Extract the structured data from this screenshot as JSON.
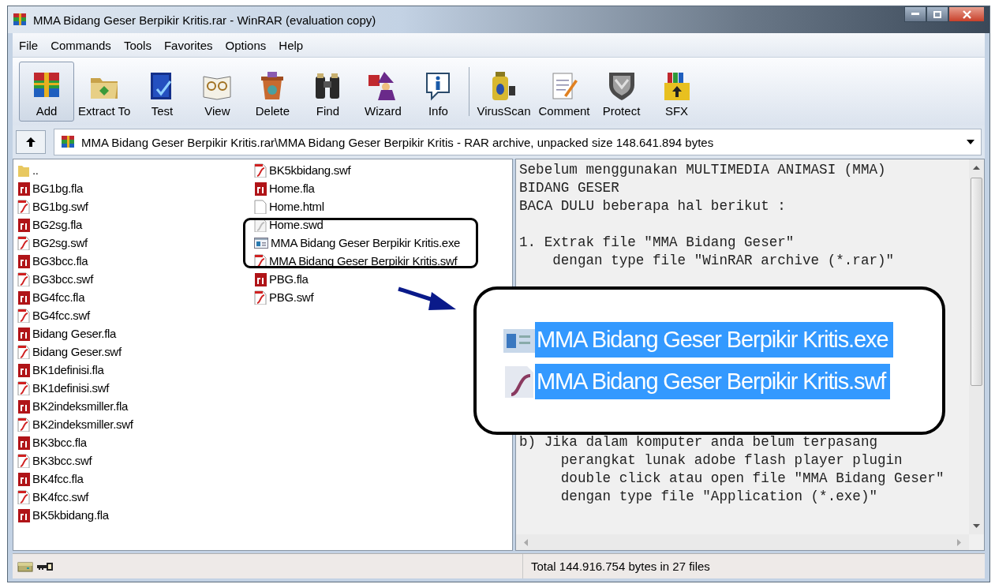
{
  "window": {
    "title": "MMA Bidang Geser Berpikir Kritis.rar - WinRAR (evaluation copy)"
  },
  "menu": [
    "File",
    "Commands",
    "Tools",
    "Favorites",
    "Options",
    "Help"
  ],
  "toolbar": {
    "groups": [
      [
        {
          "label": "Add",
          "selected": true
        },
        {
          "label": "Extract To",
          "selected": false
        },
        {
          "label": "Test",
          "selected": false
        },
        {
          "label": "View",
          "selected": false
        },
        {
          "label": "Delete",
          "selected": false
        },
        {
          "label": "Find",
          "selected": false
        },
        {
          "label": "Wizard",
          "selected": false
        },
        {
          "label": "Info",
          "selected": false
        }
      ],
      [
        {
          "label": "VirusScan",
          "selected": false
        },
        {
          "label": "Comment",
          "selected": false
        },
        {
          "label": "Protect",
          "selected": false
        },
        {
          "label": "SFX",
          "selected": false
        }
      ]
    ]
  },
  "address": {
    "path": "MMA Bidang Geser Berpikir Kritis.rar\\MMA Bidang Geser Berpikir Kritis - RAR archive, unpacked size 148.641.894 bytes"
  },
  "files": [
    {
      "name": "..",
      "kind": "folder"
    },
    {
      "name": "BG1bg.fla",
      "kind": "fla"
    },
    {
      "name": "BG1bg.swf",
      "kind": "swf"
    },
    {
      "name": "BG2sg.fla",
      "kind": "fla"
    },
    {
      "name": "BG2sg.swf",
      "kind": "swf"
    },
    {
      "name": "BG3bcc.fla",
      "kind": "fla"
    },
    {
      "name": "BG3bcc.swf",
      "kind": "swf"
    },
    {
      "name": "BG4fcc.fla",
      "kind": "fla"
    },
    {
      "name": "BG4fcc.swf",
      "kind": "swf"
    },
    {
      "name": "Bidang Geser.fla",
      "kind": "fla"
    },
    {
      "name": "Bidang Geser.swf",
      "kind": "swf"
    },
    {
      "name": "BK1definisi.fla",
      "kind": "fla"
    },
    {
      "name": "BK1definisi.swf",
      "kind": "swf"
    },
    {
      "name": "BK2indeksmiller.fla",
      "kind": "fla"
    },
    {
      "name": "BK2indeksmiller.swf",
      "kind": "swf"
    },
    {
      "name": "BK3bcc.fla",
      "kind": "fla"
    },
    {
      "name": "BK3bcc.swf",
      "kind": "swf"
    },
    {
      "name": "BK4fcc.fla",
      "kind": "fla"
    },
    {
      "name": "BK4fcc.swf",
      "kind": "swf"
    },
    {
      "name": "BK5kbidang.fla",
      "kind": "fla"
    },
    {
      "name": "BK5kbidang.swf",
      "kind": "swf"
    },
    {
      "name": "Home.fla",
      "kind": "fla"
    },
    {
      "name": "Home.html",
      "kind": "html"
    },
    {
      "name": "Home.swd",
      "kind": "swd"
    },
    {
      "name": "MMA Bidang Geser Berpikir Kritis.exe",
      "kind": "exe"
    },
    {
      "name": "MMA Bidang Geser Berpikir Kritis.swf",
      "kind": "swf"
    },
    {
      "name": "PBG.fla",
      "kind": "fla"
    },
    {
      "name": "PBG.swf",
      "kind": "swf"
    }
  ],
  "comment": {
    "top_lines": [
      "Sebelum menggunakan MULTIMEDIA ANIMASI (MMA)",
      "BIDANG GESER",
      "BACA DULU beberapa hal berikut :"
    ],
    "middle_lines": [
      "1. Extrak file \"MMA Bidang Geser\"",
      "    dengan type file \"WinRAR archive (*.rar)\""
    ],
    "bottom_lines": [
      "b) Jika dalam komputer anda belum terpasang",
      "     perangkat lunak adobe flash player plugin",
      "     double click atau open file \"MMA Bidang Geser\"",
      "     dengan type file \"Application (*.exe)\""
    ]
  },
  "callout": {
    "files": [
      {
        "name": "MMA Bidang Geser Berpikir Kritis.exe",
        "kind": "exe",
        "selected": true
      },
      {
        "name": "MMA Bidang Geser Berpikir Kritis.swf",
        "kind": "swf",
        "selected": true
      }
    ]
  },
  "status_bar": {
    "text": "Total 144.916.754 bytes in 27 files"
  }
}
